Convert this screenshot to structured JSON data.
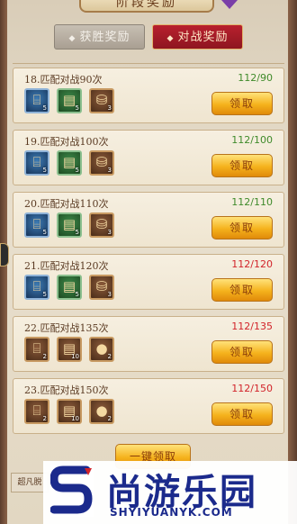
{
  "title": "阶段奖励",
  "tabs": [
    {
      "label": "获胜奖励",
      "active": false
    },
    {
      "label": "对战奖励",
      "active": true
    }
  ],
  "rows": [
    {
      "title": "18.匹配对战90次",
      "progress": "112/90",
      "progress_color": "#3f8a2a",
      "claim_label": "领取",
      "items": [
        {
          "icon": "scroll-icon",
          "style": "blue",
          "qty": "5"
        },
        {
          "icon": "book-icon",
          "style": "green",
          "qty": "5"
        },
        {
          "icon": "chest-icon",
          "style": "brown",
          "qty": "3"
        }
      ]
    },
    {
      "title": "19.匹配对战100次",
      "progress": "112/100",
      "progress_color": "#3f8a2a",
      "claim_label": "领取",
      "items": [
        {
          "icon": "scroll-icon",
          "style": "blue",
          "qty": "5"
        },
        {
          "icon": "book-icon",
          "style": "green",
          "qty": "5"
        },
        {
          "icon": "chest-icon",
          "style": "brown",
          "qty": "3"
        }
      ]
    },
    {
      "title": "20.匹配对战110次",
      "progress": "112/110",
      "progress_color": "#3f8a2a",
      "claim_label": "领取",
      "items": [
        {
          "icon": "scroll-icon",
          "style": "blue",
          "qty": "5"
        },
        {
          "icon": "book-icon",
          "style": "green",
          "qty": "5"
        },
        {
          "icon": "chest-icon",
          "style": "brown",
          "qty": "3"
        }
      ]
    },
    {
      "title": "21.匹配对战120次",
      "progress": "112/120",
      "progress_color": "#d2232a",
      "claim_label": "领取",
      "items": [
        {
          "icon": "scroll-icon",
          "style": "blue",
          "qty": "5"
        },
        {
          "icon": "book-icon",
          "style": "green",
          "qty": "5"
        },
        {
          "icon": "chest-icon",
          "style": "brown",
          "qty": "3"
        }
      ]
    },
    {
      "title": "22.匹配对战135次",
      "progress": "112/135",
      "progress_color": "#d2232a",
      "claim_label": "领取",
      "items": [
        {
          "icon": "scroll-icon",
          "style": "brown",
          "qty": "2"
        },
        {
          "icon": "book-icon",
          "style": "brown",
          "qty": "10"
        },
        {
          "icon": "pouch-icon",
          "style": "brown",
          "qty": "2"
        }
      ]
    },
    {
      "title": "23.匹配对战150次",
      "progress": "112/150",
      "progress_color": "#d2232a",
      "claim_label": "领取",
      "items": [
        {
          "icon": "scroll-icon",
          "style": "brown",
          "qty": "2"
        },
        {
          "icon": "book-icon",
          "style": "brown",
          "qty": "10"
        },
        {
          "icon": "pouch-icon",
          "style": "brown",
          "qty": "2"
        }
      ]
    }
  ],
  "claim_all_label": "一键领取",
  "bottom_left_label": "超凡脱",
  "watermark": {
    "name": "尚游乐园",
    "url": "SHYIYUANYK.COM"
  },
  "colors": {
    "accent_red": "#b8202e",
    "gold": "#f5b21c",
    "progress_ok": "#3f8a2a",
    "progress_short": "#d2232a"
  }
}
